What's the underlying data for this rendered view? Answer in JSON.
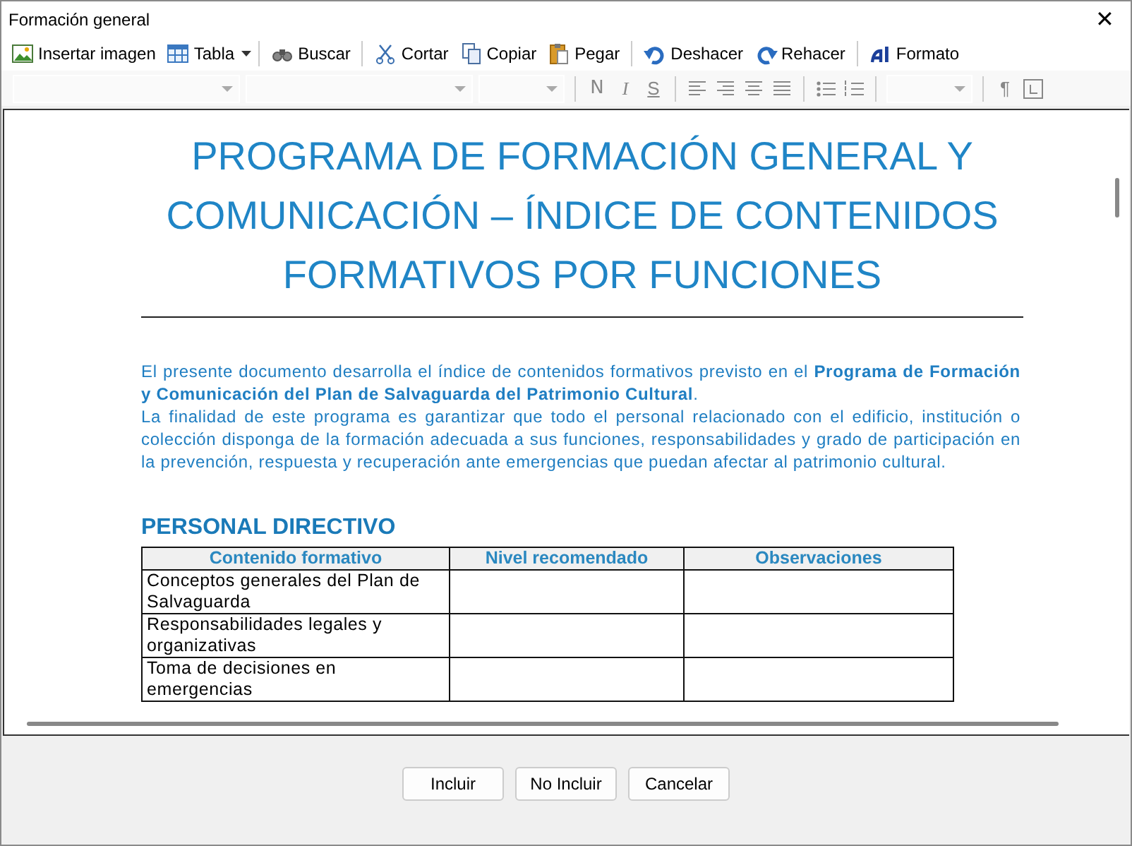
{
  "window": {
    "title": "Formación general",
    "close": "✕"
  },
  "toolbar": [
    {
      "label": "Insertar imagen"
    },
    {
      "label": "Tabla",
      "dropdown": true
    },
    {
      "label": "Buscar",
      "group_start": true
    },
    {
      "label": "Cortar",
      "group_start": true
    },
    {
      "label": "Copiar"
    },
    {
      "label": "Pegar"
    },
    {
      "label": "Deshacer",
      "group_start": true
    },
    {
      "label": "Rehacer"
    },
    {
      "label": "Formato",
      "group_start": true
    }
  ],
  "format_bar": [
    {
      "kind": "fontbox"
    },
    {
      "kind": "fontbox"
    },
    {
      "kind": "sizebox"
    },
    {
      "kind": "bold",
      "text": "N",
      "group_start": true
    },
    {
      "kind": "italic",
      "text": "I"
    },
    {
      "kind": "underline",
      "text": "S"
    },
    {
      "kind": "alignleft",
      "group_start": true
    },
    {
      "kind": "alignright"
    },
    {
      "kind": "aligncenter"
    },
    {
      "kind": "justify"
    },
    {
      "kind": "bullets",
      "group_start": true
    },
    {
      "kind": "numbering"
    },
    {
      "kind": "sizebox",
      "group_start": true
    },
    {
      "kind": "pilcrow",
      "text": "¶",
      "group_start": true
    },
    {
      "kind": "tabstop"
    }
  ],
  "document": {
    "title": "PROGRAMA DE FORMACIÓN GENERAL Y COMUNICACIÓN  – ÍNDICE DE CONTENIDOS FORMATIVOS POR FUNCIONES",
    "paragraphs": [
      "El presente documento desarrolla el índice de contenidos formativos previsto en el **Programa de Formación y Comunicación del Plan de Salvaguarda del Patrimonio Cultural**.",
      "La finalidad de este programa es garantizar que todo el personal relacionado con el edificio, institución o colección disponga de la formación adecuada a sus funciones, responsabilidades y grado de participación en la prevención, respuesta y recuperación ante emergencias que puedan afectar al patrimonio cultural."
    ],
    "section": "PERSONAL DIRECTIVO",
    "table": {
      "columns": [
        "Contenido formativo",
        "Nivel recomendado",
        "Observaciones"
      ],
      "rows": [
        [
          "Conceptos generales del Plan de Salvaguarda"
        ],
        [
          "Responsabilidades legales y organizativas"
        ],
        [
          "Toma de decisiones en emergencias"
        ]
      ]
    }
  },
  "buttons": [
    "Incluir",
    "No Incluir",
    "Cancelar"
  ]
}
